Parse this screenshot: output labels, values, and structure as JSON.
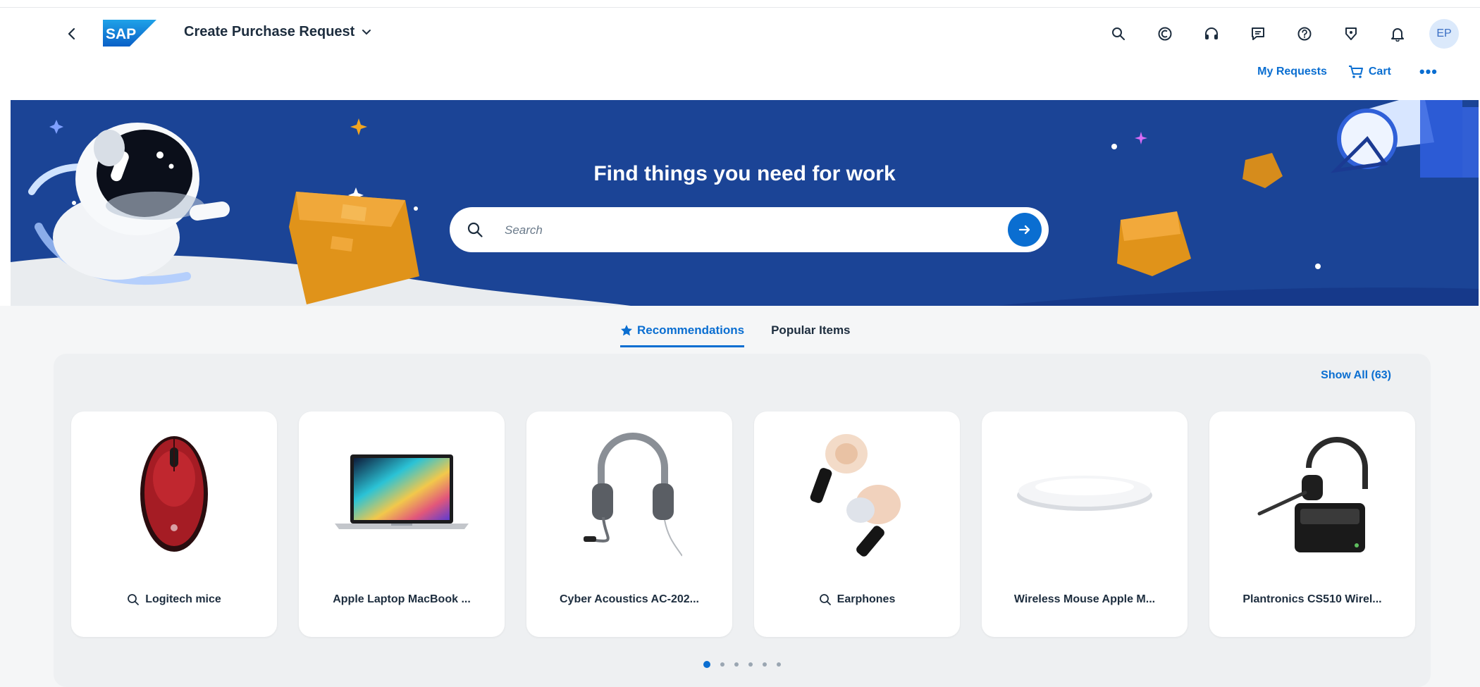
{
  "shell": {
    "app_title": "Create Purchase Request",
    "logo_text": "SAP",
    "avatar_initials": "EP",
    "icons": [
      "search-icon",
      "copilot-icon",
      "headset-icon",
      "feedback-icon",
      "help-icon",
      "whats-new-icon",
      "notification-bell-icon"
    ]
  },
  "actions": {
    "my_requests": "My Requests",
    "cart": "Cart",
    "more": "•••"
  },
  "hero": {
    "title": "Find things you need for work",
    "search_placeholder": "Search"
  },
  "tabs": [
    {
      "label": "Recommendations",
      "active": true,
      "icon": "star-icon"
    },
    {
      "label": "Popular Items",
      "active": false
    }
  ],
  "show_all": "Show All (63)",
  "cards": [
    {
      "label": "Logitech mice",
      "search_icon": true,
      "image": "mouse-icon"
    },
    {
      "label": "Apple Laptop MacBook ...",
      "search_icon": false,
      "image": "laptop-icon"
    },
    {
      "label": "Cyber Acoustics AC-202...",
      "search_icon": false,
      "image": "headset-icon"
    },
    {
      "label": "Earphones",
      "search_icon": true,
      "image": "earplugs-icon"
    },
    {
      "label": "Wireless Mouse Apple M...",
      "search_icon": false,
      "image": "magic-mouse-icon"
    },
    {
      "label": "Plantronics CS510 Wirel...",
      "search_icon": false,
      "image": "wireless-headset-icon"
    }
  ],
  "pagination": {
    "pages": 6,
    "current": 1
  },
  "colors": {
    "brand_blue": "#0a6ed1",
    "hero_blue": "#1b4496",
    "content_bg": "#f5f6f7"
  }
}
